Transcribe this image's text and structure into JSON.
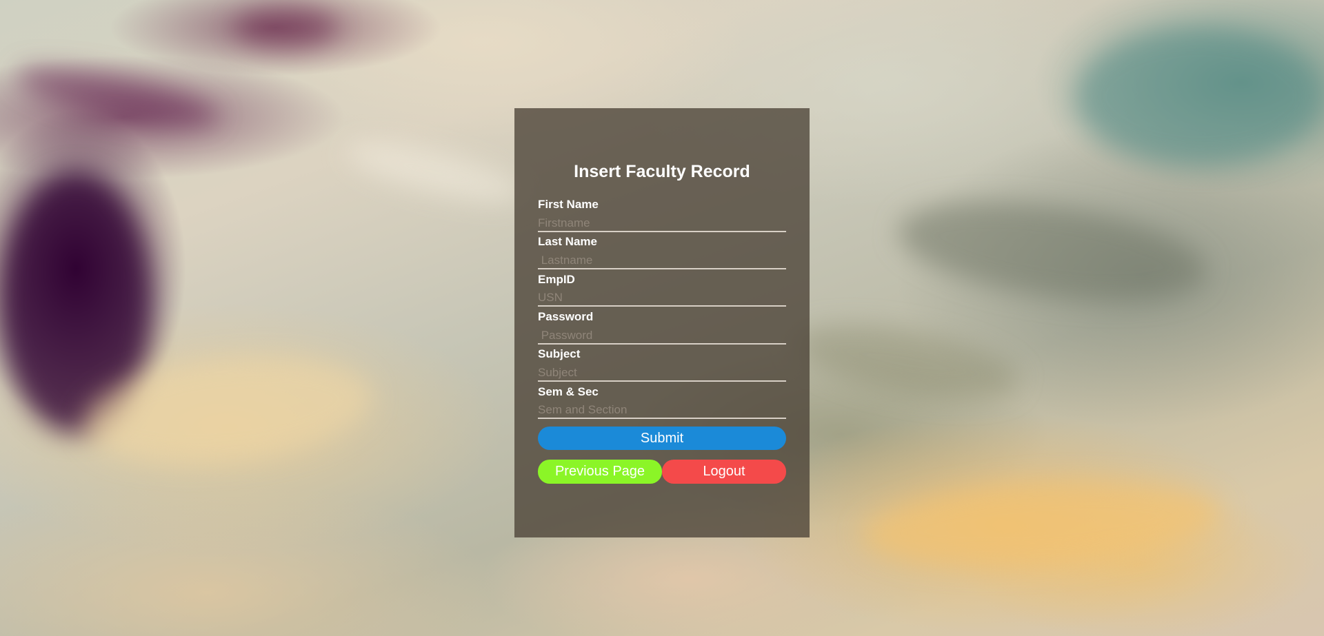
{
  "form": {
    "title": "Insert Faculty Record",
    "fields": [
      {
        "label": "First Name",
        "placeholder": "Firstname",
        "value": ""
      },
      {
        "label": "Last Name",
        "placeholder": " Lastname",
        "value": ""
      },
      {
        "label": "EmpID",
        "placeholder": "USN",
        "value": ""
      },
      {
        "label": "Password",
        "placeholder": " Password",
        "value": ""
      },
      {
        "label": "Subject",
        "placeholder": "Subject",
        "value": ""
      },
      {
        "label": "Sem & Sec",
        "placeholder": "Sem and Section",
        "value": ""
      }
    ],
    "submit_label": "Submit",
    "previous_label": "Previous Page",
    "logout_label": "Logout"
  },
  "colors": {
    "card_overlay": "#4b4237",
    "submit_button": "#1b8ad8",
    "previous_button": "#8bf527",
    "logout_button": "#f44a4a"
  }
}
